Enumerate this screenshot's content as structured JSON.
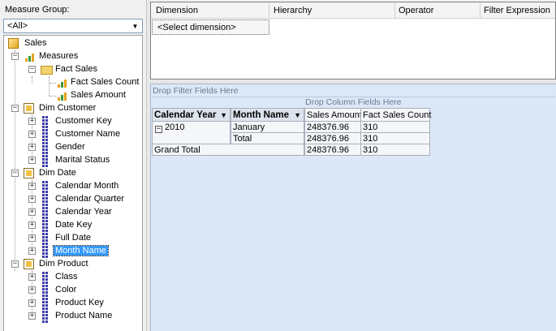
{
  "left_panel": {
    "measure_group_label": "Measure Group:",
    "measure_group_value": "<All>",
    "tree": {
      "root": "Sales",
      "measures": "Measures",
      "fact_sales": "Fact Sales",
      "fact_sales_count": "Fact Sales Count",
      "sales_amount": "Sales Amount",
      "dim_customer": "Dim Customer",
      "customer_key": "Customer Key",
      "customer_name": "Customer Name",
      "gender": "Gender",
      "marital_status": "Marital Status",
      "dim_date": "Dim Date",
      "calendar_month": "Calendar Month",
      "calendar_quarter": "Calendar Quarter",
      "calendar_year": "Calendar Year",
      "date_key": "Date Key",
      "full_date": "Full Date",
      "month_name": "Month Name",
      "dim_product": "Dim Product",
      "class": "Class",
      "color": "Color",
      "product_key": "Product Key",
      "product_name": "Product Name"
    }
  },
  "filter_grid": {
    "columns": [
      "Dimension",
      "Hierarchy",
      "Operator",
      "Filter Expression"
    ],
    "select_dimension": "<Select dimension>"
  },
  "pivot": {
    "drop_filter": "Drop Filter Fields Here",
    "drop_column": "Drop Column Fields Here",
    "row_headers": [
      "Calendar Year",
      "Month Name"
    ],
    "measure_headers": [
      "Sales Amount",
      "Fact Sales Count"
    ],
    "rows": [
      {
        "year": "2010",
        "month": "January",
        "sales_amount": "248376.96",
        "fact_sales_count": "310"
      },
      {
        "year": "",
        "month": "Total",
        "sales_amount": "248376.96",
        "fact_sales_count": "310"
      }
    ],
    "grand_total": {
      "label": "Grand Total",
      "sales_amount": "248376.96",
      "fact_sales_count": "310"
    }
  },
  "colors": {
    "pivot_background": "#dce8f8",
    "selection": "#3399ff",
    "attribute_icon": "#3c3ca8",
    "measure_bar_orange": "#e8a020",
    "measure_bar_green": "#3a9a3a"
  },
  "icons": {
    "cube": "cube-icon",
    "measures": "bar-chart-icon",
    "folder": "folder-icon",
    "dimension": "dimension-icon",
    "attribute": "attribute-hierarchy-icon"
  }
}
